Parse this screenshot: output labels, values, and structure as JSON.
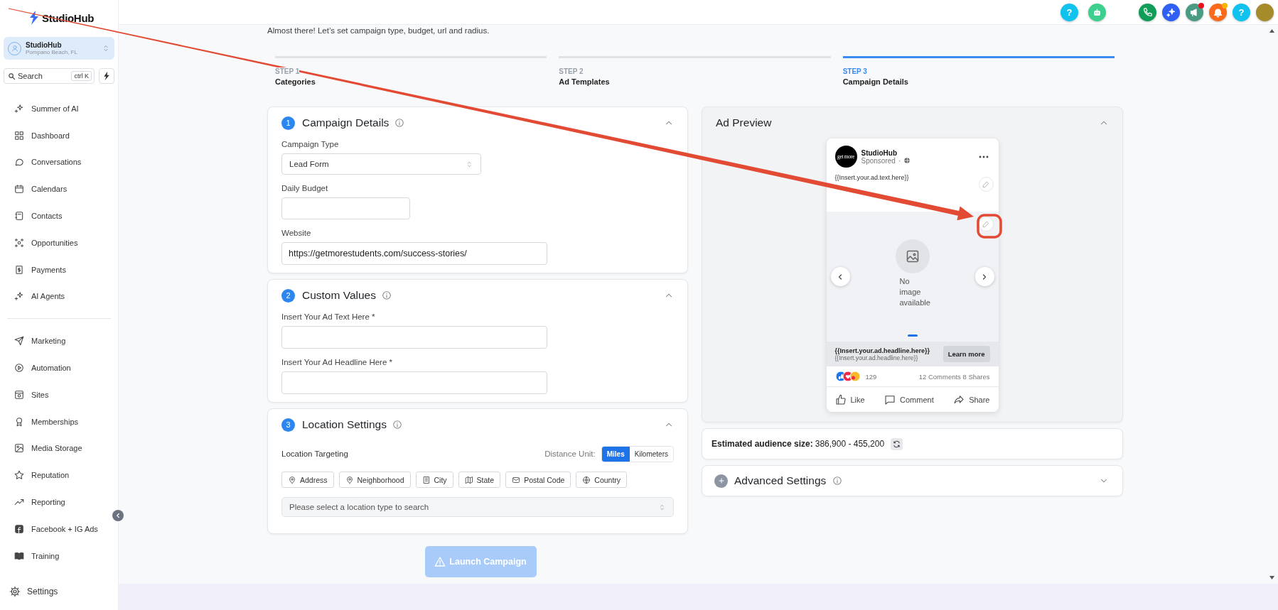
{
  "app": {
    "name": "StudioHub"
  },
  "sidebar": {
    "account": {
      "name": "StudioHub",
      "location": "Pompano Beach, FL"
    },
    "search": {
      "placeholder": "Search",
      "shortcut": "ctrl K"
    },
    "groups": [
      [
        {
          "label": "Summer of AI",
          "selected": false
        },
        {
          "label": "Dashboard",
          "selected": false
        },
        {
          "label": "Conversations",
          "selected": false
        },
        {
          "label": "Calendars",
          "selected": false
        },
        {
          "label": "Contacts",
          "selected": false
        },
        {
          "label": "Opportunities",
          "selected": false
        },
        {
          "label": "Payments",
          "selected": false
        },
        {
          "label": "AI Agents",
          "selected": false
        }
      ],
      [
        {
          "label": "Marketing",
          "selected": false
        },
        {
          "label": "Automation",
          "selected": false
        },
        {
          "label": "Sites",
          "selected": false
        },
        {
          "label": "Memberships",
          "selected": false
        },
        {
          "label": "Media Storage",
          "selected": false
        },
        {
          "label": "Reputation",
          "selected": false
        },
        {
          "label": "Reporting",
          "selected": false
        },
        {
          "label": "Facebook + IG Ads",
          "selected": false
        },
        {
          "label": "Training",
          "selected": false
        }
      ]
    ],
    "settings": {
      "label": "Settings",
      "selected": false
    }
  },
  "header_buttons": [
    {
      "kind": "help",
      "label": "?"
    },
    {
      "kind": "bot"
    },
    {
      "kind": "phone"
    },
    {
      "kind": "ai"
    },
    {
      "kind": "megaphone",
      "color": "#e8121f"
    },
    {
      "kind": "bell",
      "color": "#f5b400"
    },
    {
      "kind": "help",
      "label": "?"
    },
    {
      "kind": "avatar"
    }
  ],
  "subtitle": "Almost there! Let’s set campaign type, budget, url and radius.",
  "steps": [
    {
      "label": "STEP 1",
      "title": "Categories",
      "selected": false
    },
    {
      "label": "STEP 2",
      "title": "Ad Templates",
      "selected": false
    },
    {
      "label": "STEP 3",
      "title": "Campaign Details",
      "selected": true
    }
  ],
  "sections": [
    {
      "number": "1",
      "title": "Campaign Details",
      "expanded": true,
      "fields": [
        {
          "kind": "select",
          "label": "Campaign Type",
          "value": "Lead Form"
        },
        {
          "kind": "number",
          "label": "Daily Budget"
        },
        {
          "kind": "text",
          "label": "Website",
          "value": "https://getmorestudents.com/success-stories/"
        }
      ]
    },
    {
      "number": "2",
      "title": "Custom Values",
      "expanded": true,
      "fields": [
        {
          "kind": "text",
          "label": "Insert Your Ad Text Here *"
        },
        {
          "kind": "text",
          "label": "Insert Your Ad Headline Here *"
        }
      ]
    },
    {
      "number": "3",
      "title": "Location Settings",
      "expanded": true,
      "location": {
        "targeting_label": "Location Targeting",
        "distance_label": "Distance Unit:",
        "units": [
          {
            "label": "Miles",
            "selected": true
          },
          {
            "label": "Kilometers",
            "selected": false
          }
        ],
        "types": [
          {
            "label": "Address"
          },
          {
            "label": "Neighborhood"
          },
          {
            "label": "City"
          },
          {
            "label": "State"
          },
          {
            "label": "Postal Code"
          },
          {
            "label": "Country"
          }
        ],
        "search": {
          "placeholder": "Please select a location type to search"
        }
      }
    }
  ],
  "launch_button": {
    "label": "Launch Campaign",
    "disabled": true
  },
  "ad_preview": {
    "title": "Ad Preview",
    "expanded": true,
    "post": {
      "avatar_text": "get more",
      "page_name": "StudioHub",
      "sponsored": "Sponsored",
      "separator": "·",
      "ad_text": "{{Insert.your.ad.text.here}}",
      "no_image": "No image available",
      "slides": [
        {
          "selected": true
        }
      ],
      "headline": "{{Insert.your.ad.headline.here}}",
      "description": "{{Insert.your.ad.headline.here}}",
      "cta": "Learn more",
      "reaction_count": "129",
      "engagement": "12 Comments 8 Shares",
      "actions": [
        "Like",
        "Comment",
        "Share"
      ]
    }
  },
  "audience": {
    "label": "Estimated audience size:",
    "value": "386,900 - 455,200"
  },
  "advanced": {
    "title": "Advanced Settings",
    "expanded": false
  }
}
